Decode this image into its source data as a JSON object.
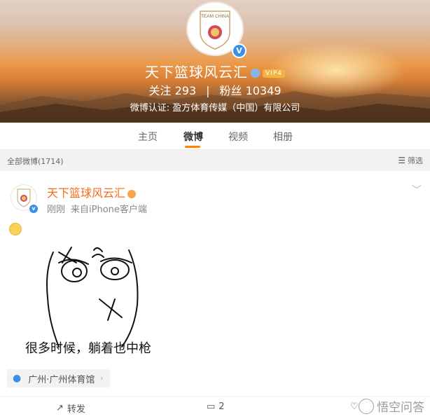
{
  "profile": {
    "avatar_logo_text": "TEAM CHINA",
    "name": "天下篮球风云汇",
    "vip_badge": "VIP4",
    "follow_label": "关注",
    "follow_count": "293",
    "separator": "|",
    "fans_label": "粉丝",
    "fans_count": "10349",
    "verification": "微博认证: 盈方体育传媒（中国）有限公司"
  },
  "tabs": [
    {
      "label": "主页",
      "active": false
    },
    {
      "label": "微博",
      "active": true
    },
    {
      "label": "视频",
      "active": false
    },
    {
      "label": "相册",
      "active": false
    }
  ],
  "filter": {
    "count_label": "全部微博(1714)",
    "filter_label": "筛选",
    "filter_icon": "filter-icon"
  },
  "post": {
    "author": "天下篮球风云汇",
    "time": "刚刚",
    "source": "来自iPhone客户端",
    "emoji": "smile-emoji",
    "image_caption": "很多时候，躺着也中枪",
    "location": "广州·广州体育馆"
  },
  "actions": {
    "repost_label": "转发",
    "comment_count": "2"
  },
  "watermark": "悟空问答",
  "colors": {
    "accent": "#ff8200",
    "author_name": "#f86a1a",
    "verified_blue": "#3a8fe6"
  }
}
